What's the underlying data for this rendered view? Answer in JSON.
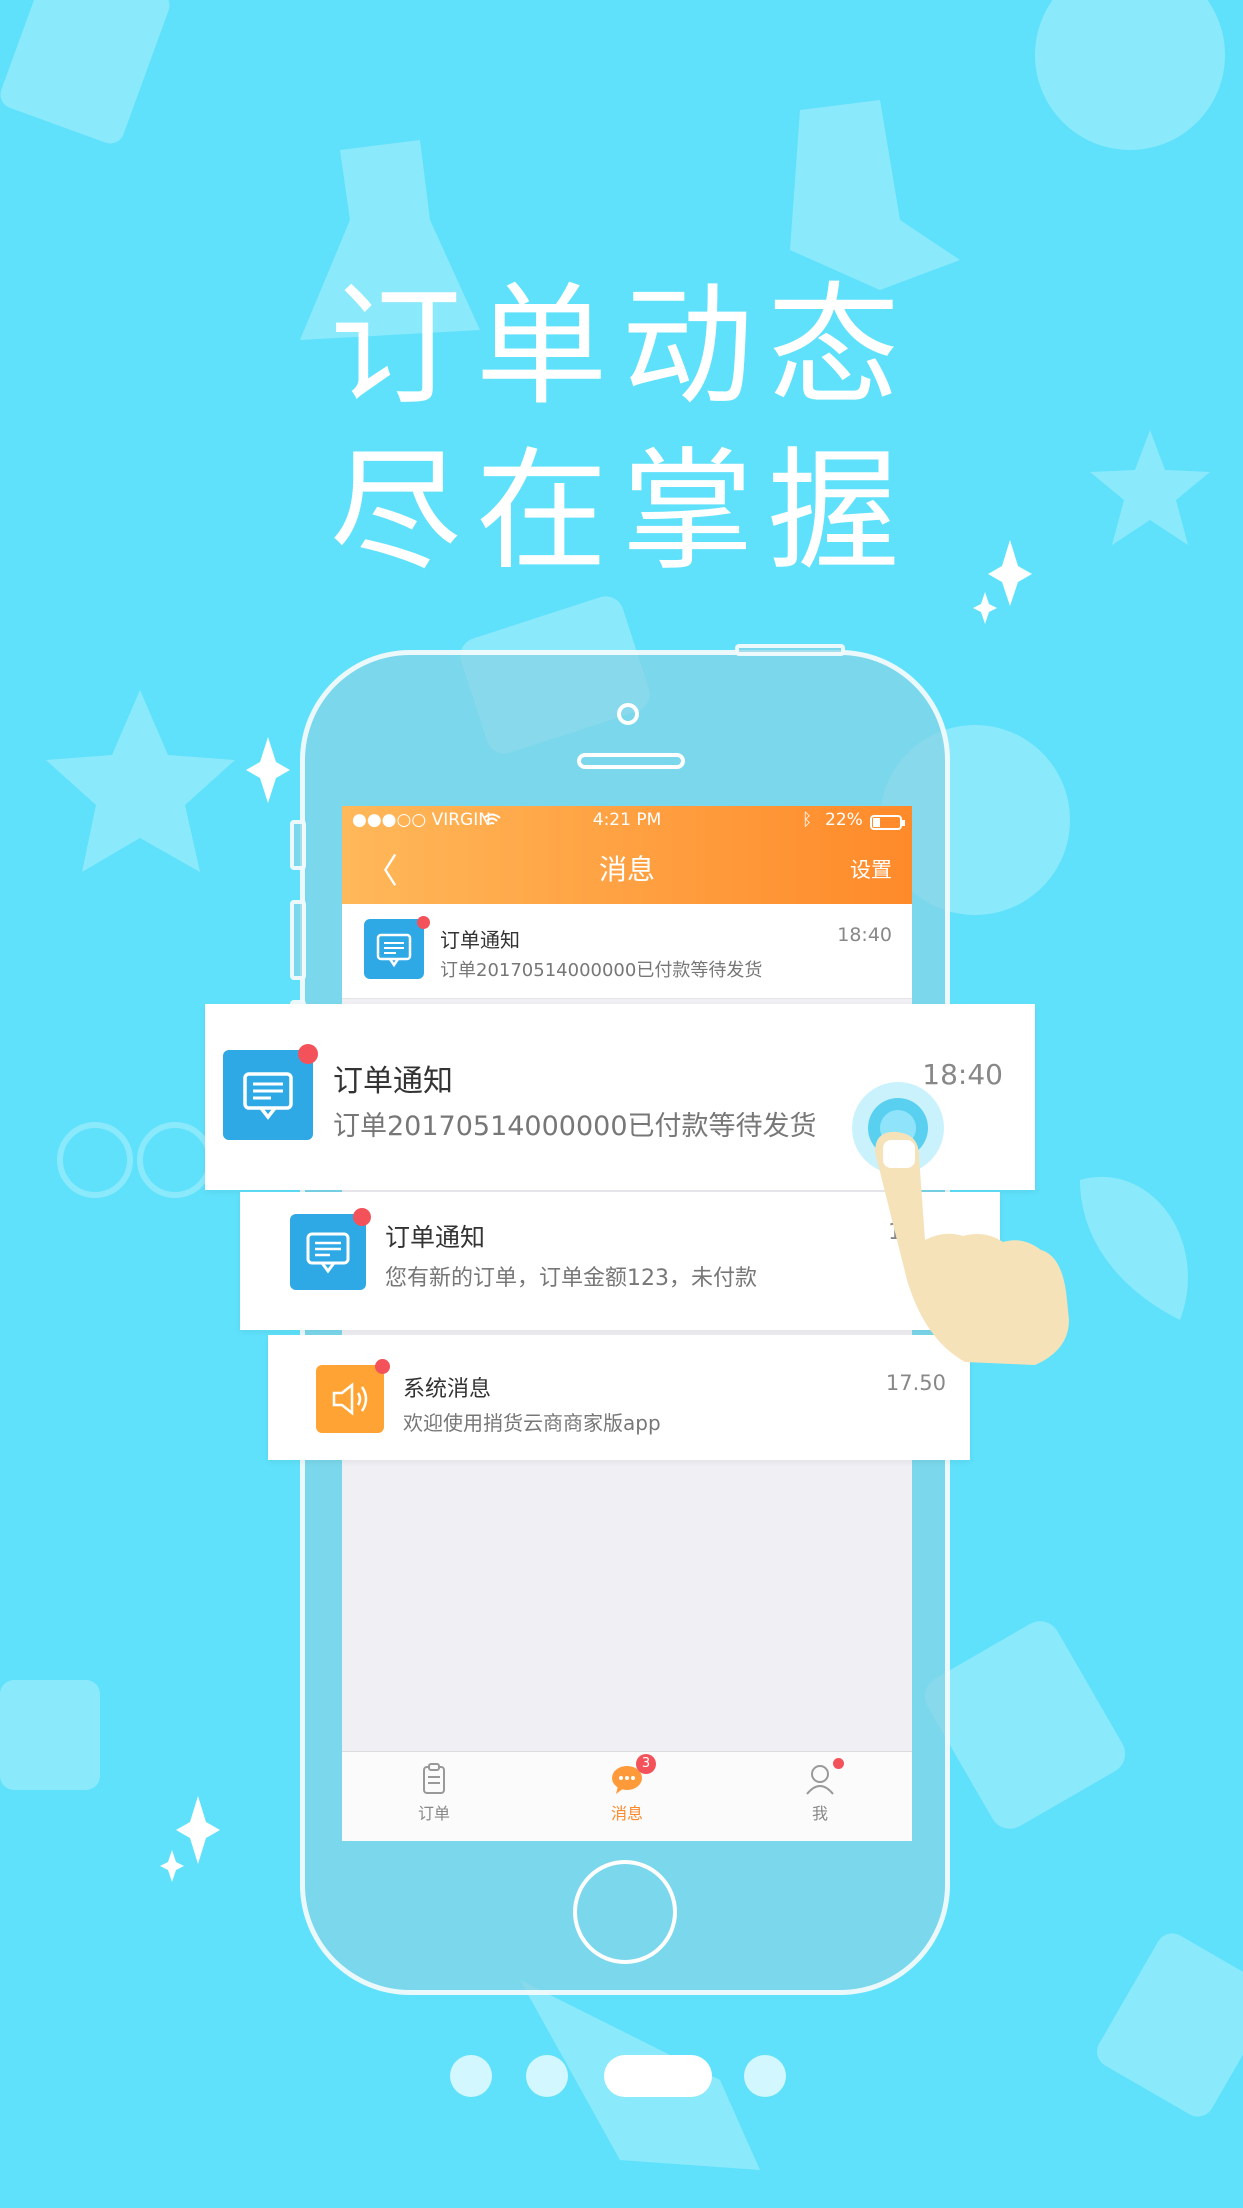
{
  "headline": {
    "line1": "订单动态",
    "line2": "尽在掌握"
  },
  "status_bar": {
    "carrier": "●●●○○ VIRGIN",
    "time": "4:21 PM",
    "battery": "22%"
  },
  "nav": {
    "back": "〈",
    "title": "消息",
    "settings": "设置"
  },
  "list_row": {
    "title": "订单通知",
    "time": "18:40",
    "subtitle": "订单20170514000000已付款等待发货"
  },
  "cards": [
    {
      "title": "订单通知",
      "time": "18:40",
      "subtitle": "订单20170514000000已付款等待发货",
      "icon": "message-icon"
    },
    {
      "title": "订单通知",
      "time": "1",
      "subtitle": "您有新的订单，订单金额123，未付款",
      "icon": "message-icon"
    },
    {
      "title": "系统消息",
      "time": "17.50",
      "subtitle": "欢迎使用捎货云商商家版app",
      "icon": "speaker-icon"
    }
  ],
  "tabs": [
    {
      "label": "订单",
      "icon": "clipboard-icon"
    },
    {
      "label": "消息",
      "icon": "chat-icon",
      "badge": "3"
    },
    {
      "label": "我",
      "icon": "user-icon"
    }
  ],
  "pager": {
    "total": 4,
    "active": 3
  },
  "colors": {
    "background": "#5fe1fb",
    "accent": "#ff8a2a",
    "blue_icon": "#2ea9e6",
    "orange_icon": "#ffa434",
    "badge": "#f4525a"
  }
}
